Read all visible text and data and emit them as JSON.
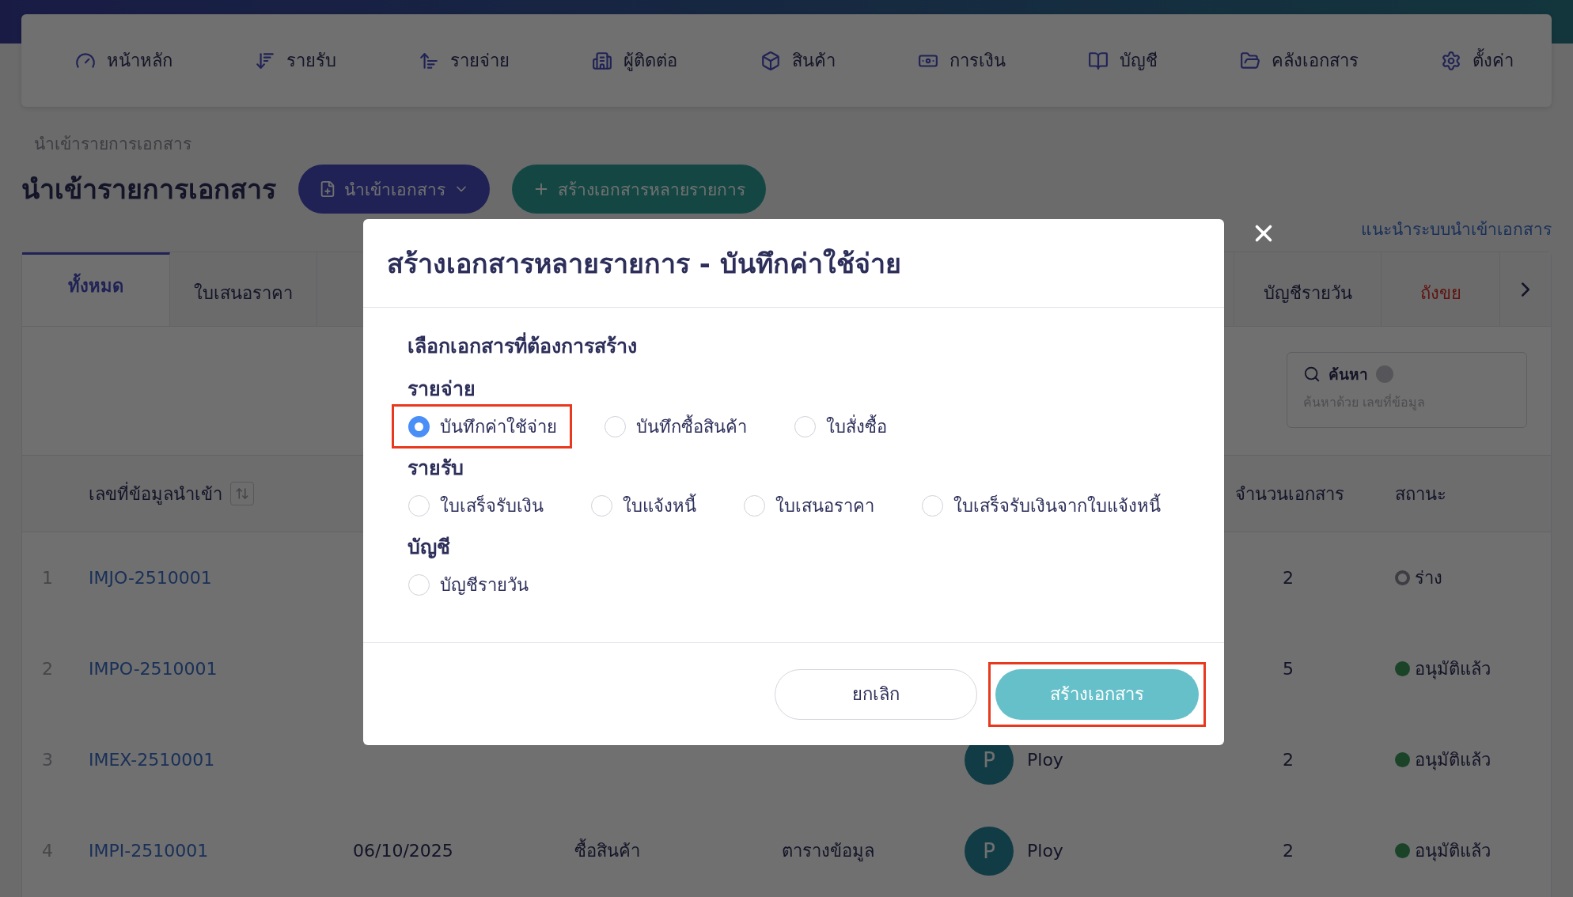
{
  "nav": [
    {
      "label": "หน้าหลัก"
    },
    {
      "label": "รายรับ"
    },
    {
      "label": "รายจ่าย"
    },
    {
      "label": "ผู้ติดต่อ"
    },
    {
      "label": "สินค้า"
    },
    {
      "label": "การเงิน"
    },
    {
      "label": "บัญชี"
    },
    {
      "label": "คลังเอกสาร"
    },
    {
      "label": "ตั้งค่า"
    }
  ],
  "breadcrumb": "นำเข้ารายการเอกสาร",
  "page_title": "นำเข้ารายการเอกสาร",
  "import_button": "นำเข้าเอกสาร",
  "create_multi_button": "สร้างเอกสารหลายรายการ",
  "guide_link": "แนะนำระบบนำเข้าเอกสาร",
  "tabs": [
    {
      "label": "ทั้งหมด",
      "selected": true,
      "kind": "normal"
    },
    {
      "label": "ใบเสนอราคา",
      "selected": false,
      "kind": "normal"
    },
    {
      "label": "บัญชีรายวัน",
      "selected": false,
      "kind": "normal"
    },
    {
      "label": "ถังขย",
      "selected": false,
      "kind": "danger"
    }
  ],
  "search": {
    "label": "ค้นหา",
    "placeholder": "ค้นหาด้วย เลขที่ข้อมูล"
  },
  "table": {
    "columns": [
      {
        "label": "เลขที่ข้อมูลนำเข้า",
        "sortable": true
      },
      {
        "label": "จำนวนเอกสาร",
        "sortable": false
      },
      {
        "label": "สถานะ",
        "sortable": false
      }
    ],
    "rows": [
      {
        "number": "1",
        "id": "IMJO-2510001",
        "count": "2",
        "status": {
          "label": "ร่าง",
          "kind": "draft"
        }
      },
      {
        "number": "2",
        "id": "IMPO-2510001",
        "count": "5",
        "status": {
          "label": "อนุมัติแล้ว",
          "kind": "approved"
        }
      },
      {
        "number": "3",
        "id": "IMEX-2510001",
        "user": {
          "initial": "P",
          "name": "Ploy"
        },
        "count": "2",
        "status": {
          "label": "อนุมัติแล้ว",
          "kind": "approved"
        }
      },
      {
        "number": "4",
        "id": "IMPI-2510001",
        "date": "06/10/2025",
        "type": "ซื้อสินค้า",
        "reference": "ตารางข้อมูล",
        "user": {
          "initial": "P",
          "name": "Ploy"
        },
        "count": "2",
        "status": {
          "label": "อนุมัติแล้ว",
          "kind": "approved"
        }
      }
    ]
  },
  "modal": {
    "title": "สร้างเอกสารหลายรายการ - บันทึกค่าใช้จ่าย",
    "prompt": "เลือกเอกสารที่ต้องการสร้าง",
    "groups": [
      {
        "label": "รายจ่าย",
        "options": [
          {
            "label": "บันทึกค่าใช้จ่าย",
            "selected": true,
            "highlighted": true
          },
          {
            "label": "บันทึกซื้อสินค้า",
            "selected": false,
            "highlighted": false
          },
          {
            "label": "ใบสั่งซื้อ",
            "selected": false,
            "highlighted": false
          }
        ]
      },
      {
        "label": "รายรับ",
        "options": [
          {
            "label": "ใบเสร็จรับเงิน",
            "selected": false,
            "highlighted": false
          },
          {
            "label": "ใบแจ้งหนี้",
            "selected": false,
            "highlighted": false
          },
          {
            "label": "ใบเสนอราคา",
            "selected": false,
            "highlighted": false
          },
          {
            "label": "ใบเสร็จรับเงินจากใบแจ้งหนี้",
            "selected": false,
            "highlighted": false
          }
        ]
      },
      {
        "label": "บัญชี",
        "options": [
          {
            "label": "บัญชีรายวัน",
            "selected": false,
            "highlighted": false
          }
        ]
      }
    ],
    "cancel_button": "ยกเลิก",
    "confirm_button": {
      "label": "สร้างเอกสาร",
      "highlighted": true
    }
  }
}
